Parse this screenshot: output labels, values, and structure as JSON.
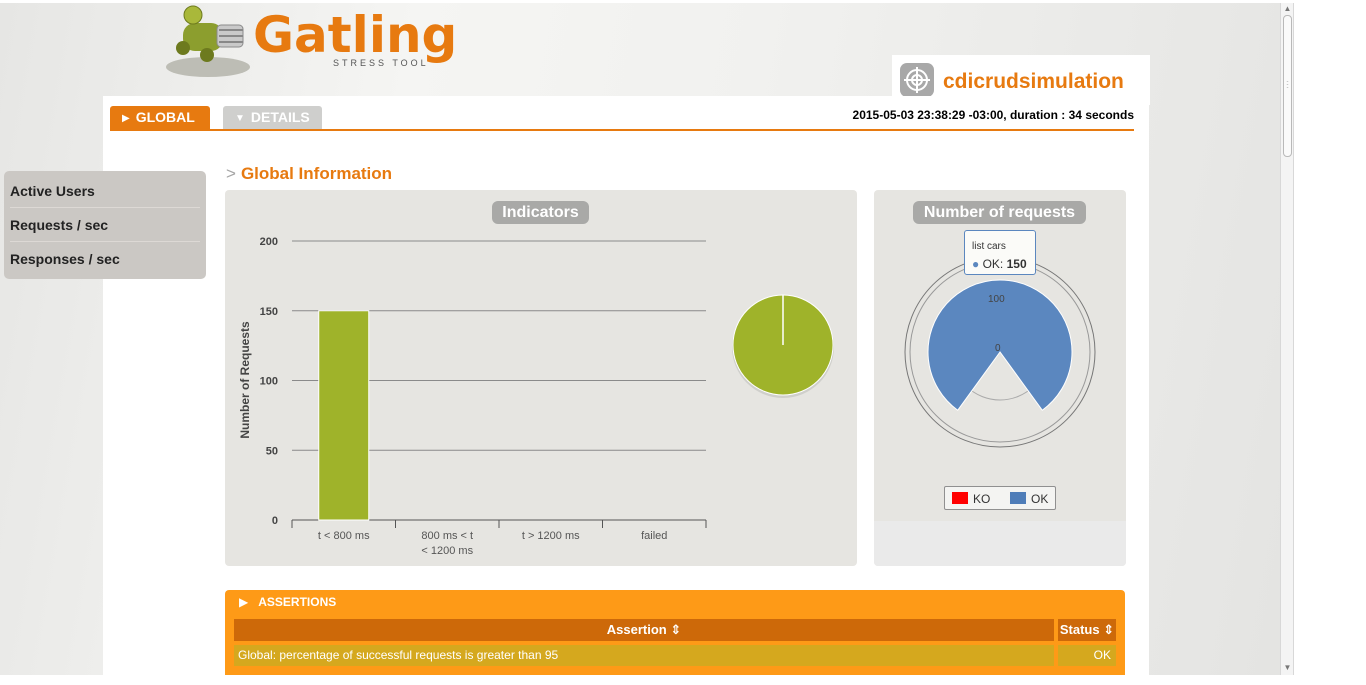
{
  "logo": {
    "name": "Gatling",
    "subtitle": "STRESS TOOL"
  },
  "simulation": {
    "name": "cdicrudsimulation"
  },
  "tabs": [
    {
      "label": "GLOBAL",
      "active": true
    },
    {
      "label": "DETAILS",
      "active": false
    }
  ],
  "run_info": "2015-05-03 23:38:29 -03:00, duration : 34 seconds",
  "side_menu": {
    "items": [
      "Active Users",
      "Requests / sec",
      "Responses / sec"
    ]
  },
  "section_title": "Global Information",
  "section_prefix": ">",
  "colors": {
    "accent": "#e77a10",
    "bar_green": "#9fb32a",
    "ok_blue": "#5b87bf",
    "ko_red": "#ff0000"
  },
  "indicators": {
    "title": "Indicators",
    "ylabel": "Number of Requests"
  },
  "number_of_requests": {
    "title": "Number of requests",
    "tooltip": {
      "title": "list cars",
      "label": "OK:",
      "value": "150"
    },
    "legend": [
      {
        "label": "KO",
        "color": "#ff0000"
      },
      {
        "label": "OK",
        "color": "#4f7db8"
      }
    ]
  },
  "assertions": {
    "header": "ASSERTIONS",
    "columns": [
      "Assertion",
      "Status"
    ],
    "rows": [
      {
        "assertion": "Global: percentage of successful requests is greater than 95",
        "status": "OK"
      }
    ]
  },
  "chart_data": [
    {
      "type": "bar",
      "title": "Indicators",
      "xlabel": "",
      "ylabel": "Number of Requests",
      "categories": [
        "t < 800 ms",
        "800 ms < t < 1200 ms",
        "t > 1200 ms",
        "failed"
      ],
      "values": [
        150,
        0,
        0,
        0
      ],
      "ylim": [
        0,
        200
      ],
      "yticks": [
        0,
        50,
        100,
        150,
        200
      ],
      "grid": true
    },
    {
      "type": "pie",
      "categories": [
        "t < 800 ms",
        "800 ms < t < 1200 ms",
        "t > 1200 ms",
        "failed"
      ],
      "values": [
        150,
        0,
        0,
        0
      ]
    },
    {
      "type": "area",
      "title": "Number of requests",
      "categories": [
        "list cars"
      ],
      "series": [
        {
          "name": "KO",
          "values": [
            0
          ]
        },
        {
          "name": "OK",
          "values": [
            150
          ]
        }
      ],
      "ticks": [
        "0",
        "100"
      ]
    }
  ]
}
